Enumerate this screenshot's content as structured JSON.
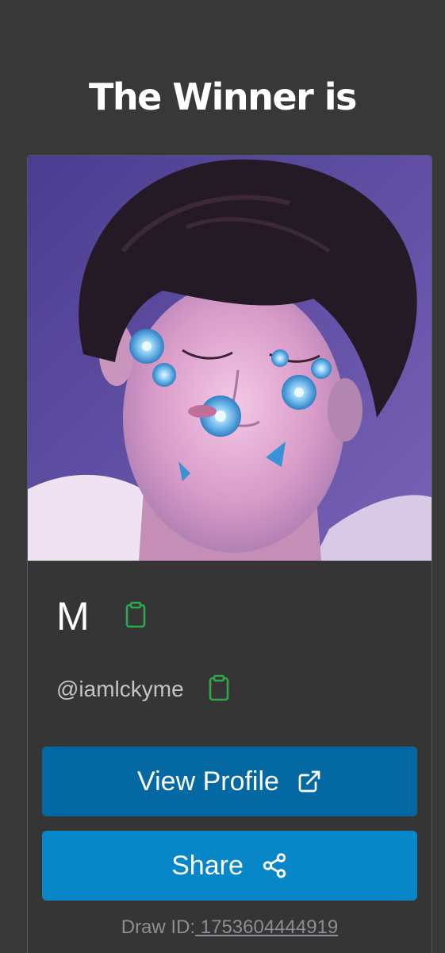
{
  "header": {
    "title": "The Winner is"
  },
  "winner": {
    "name": "M",
    "handle": "@iamlckyme",
    "photo_alt": "Winner profile photo"
  },
  "actions": {
    "view_profile_label": "View Profile",
    "share_label": "Share"
  },
  "draw": {
    "label": "Draw ID:",
    "id": " 1753604444919"
  },
  "icons": {
    "copy": "clipboard-icon",
    "external": "external-link-icon",
    "share": "share-icon"
  },
  "colors": {
    "background": "#383838",
    "copy_icon": "#2fa84a",
    "view_profile_button": "#0468a3",
    "share_button": "#0787c8"
  }
}
